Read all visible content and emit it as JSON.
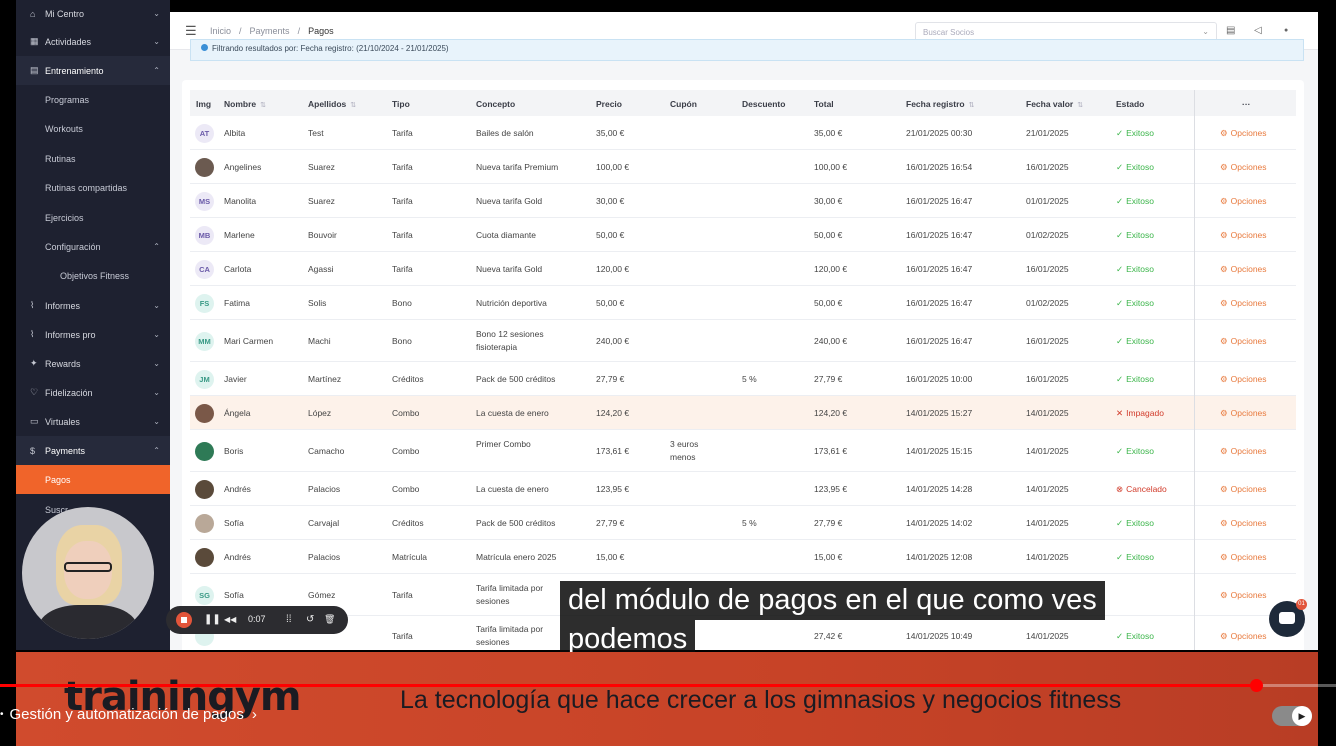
{
  "sidebar": {
    "items": [
      {
        "label": "Mi Centro",
        "icon": "home-icon",
        "chevron": "⌄"
      },
      {
        "label": "Actividades",
        "icon": "calendar-icon",
        "chevron": "⌄"
      },
      {
        "label": "Entrenamiento",
        "icon": "clipboard-icon",
        "chevron": "⌃"
      },
      {
        "label": "Programas"
      },
      {
        "label": "Workouts"
      },
      {
        "label": "Rutinas"
      },
      {
        "label": "Rutinas compartidas"
      },
      {
        "label": "Ejercicios"
      },
      {
        "label": "Configuración",
        "chevron": "⌃"
      },
      {
        "label": "Objetivos Fitness"
      },
      {
        "label": "Informes",
        "icon": "chart-icon",
        "chevron": "⌄"
      },
      {
        "label": "Informes pro",
        "icon": "chart-pro-icon",
        "chevron": "⌄"
      },
      {
        "label": "Rewards",
        "icon": "gift-icon",
        "chevron": "⌄"
      },
      {
        "label": "Fidelización",
        "icon": "heart-icon",
        "chevron": "⌄"
      },
      {
        "label": "Virtuales",
        "icon": "video-icon",
        "chevron": "⌄"
      },
      {
        "label": "Payments",
        "icon": "dollar-icon",
        "chevron": "⌃"
      },
      {
        "label": "Pagos"
      },
      {
        "label": "Suscr"
      }
    ]
  },
  "topbar": {
    "menu_glyph": "☰",
    "breadcrumb": [
      "Inicio",
      "/",
      "Payments",
      "/",
      "Pagos"
    ],
    "search_placeholder": "Buscar Socios",
    "search_caret": "⌄",
    "icons": [
      "▤",
      "◁",
      "●"
    ]
  },
  "filter": {
    "text": "Filtrando resultados por: Fecha registro: (21/10/2024 - 21/01/2025)"
  },
  "table": {
    "headers": [
      "Img",
      "Nombre",
      "Apellidos",
      "Tipo",
      "Concepto",
      "Precio",
      "Cupón",
      "Descuento",
      "Total",
      "Fecha registro",
      "Fecha valor",
      "Estado",
      "···"
    ],
    "options_label": "Opciones",
    "rows": [
      {
        "initials": "AT",
        "av_bg": "#ece9f6",
        "av_fg": "#6a5aa8",
        "nombre": "Albita",
        "apellidos": "Test",
        "tipo": "Tarifa",
        "concepto": "Bailes de salón",
        "precio": "35,00 €",
        "cupon": "",
        "descuento": "",
        "total": "35,00 €",
        "fecha_registro": "21/01/2025 00:30",
        "fecha_valor": "21/01/2025",
        "estado": "Exitoso",
        "estado_glyph": "✓",
        "status": "ok"
      },
      {
        "initials": "",
        "av_bg": "#6b5a50",
        "av_fg": "#fff",
        "nombre": "Angelines",
        "apellidos": "Suarez",
        "tipo": "Tarifa",
        "concepto": "Nueva tarifa Premium",
        "precio": "100,00 €",
        "cupon": "",
        "descuento": "",
        "total": "100,00 €",
        "fecha_registro": "16/01/2025 16:54",
        "fecha_valor": "16/01/2025",
        "estado": "Exitoso",
        "estado_glyph": "✓",
        "status": "ok"
      },
      {
        "initials": "MS",
        "av_bg": "#ece9f6",
        "av_fg": "#6a5aa8",
        "nombre": "Manolita",
        "apellidos": "Suarez",
        "tipo": "Tarifa",
        "concepto": "Nueva tarifa Gold",
        "precio": "30,00 €",
        "cupon": "",
        "descuento": "",
        "total": "30,00 €",
        "fecha_registro": "16/01/2025 16:47",
        "fecha_valor": "01/01/2025",
        "estado": "Exitoso",
        "estado_glyph": "✓",
        "status": "ok"
      },
      {
        "initials": "MB",
        "av_bg": "#ece9f6",
        "av_fg": "#6a5aa8",
        "nombre": "Marlene",
        "apellidos": "Bouvoir",
        "tipo": "Tarifa",
        "concepto": "Cuota diamante",
        "precio": "50,00 €",
        "cupon": "",
        "descuento": "",
        "total": "50,00 €",
        "fecha_registro": "16/01/2025 16:47",
        "fecha_valor": "01/02/2025",
        "estado": "Exitoso",
        "estado_glyph": "✓",
        "status": "ok"
      },
      {
        "initials": "CA",
        "av_bg": "#ece9f6",
        "av_fg": "#6a5aa8",
        "nombre": "Carlota",
        "apellidos": "Agassi",
        "tipo": "Tarifa",
        "concepto": "Nueva tarifa Gold",
        "precio": "120,00 €",
        "cupon": "",
        "descuento": "",
        "total": "120,00 €",
        "fecha_registro": "16/01/2025 16:47",
        "fecha_valor": "16/01/2025",
        "estado": "Exitoso",
        "estado_glyph": "✓",
        "status": "ok"
      },
      {
        "initials": "FS",
        "av_bg": "#def3ef",
        "av_fg": "#3a9a86",
        "nombre": "Fatima",
        "apellidos": "Solis",
        "tipo": "Bono",
        "concepto": "Nutrición deportiva",
        "precio": "50,00 €",
        "cupon": "",
        "descuento": "",
        "total": "50,00 €",
        "fecha_registro": "16/01/2025 16:47",
        "fecha_valor": "01/02/2025",
        "estado": "Exitoso",
        "estado_glyph": "✓",
        "status": "ok"
      },
      {
        "initials": "MM",
        "av_bg": "#def3ef",
        "av_fg": "#3a9a86",
        "nombre": "Mari Carmen",
        "apellidos": "Machi",
        "tipo": "Bono",
        "concepto": "Bono 12 sesiones fisioterapia",
        "precio": "240,00 €",
        "cupon": "",
        "descuento": "",
        "total": "240,00 €",
        "fecha_registro": "16/01/2025 16:47",
        "fecha_valor": "16/01/2025",
        "estado": "Exitoso",
        "estado_glyph": "✓",
        "status": "ok",
        "tall": true
      },
      {
        "initials": "JM",
        "av_bg": "#def3ef",
        "av_fg": "#3a9a86",
        "nombre": "Javier",
        "apellidos": "Martínez",
        "tipo": "Créditos",
        "concepto": "Pack de 500 créditos",
        "precio": "27,79 €",
        "cupon": "",
        "descuento": "5 %",
        "total": "27,79 €",
        "fecha_registro": "16/01/2025 10:00",
        "fecha_valor": "16/01/2025",
        "estado": "Exitoso",
        "estado_glyph": "✓",
        "status": "ok"
      },
      {
        "initials": "",
        "av_bg": "#7a5848",
        "av_fg": "#fff",
        "nombre": "Ángela",
        "apellidos": "López",
        "tipo": "Combo",
        "concepto": "La cuesta de enero",
        "precio": "124,20 €",
        "cupon": "",
        "descuento": "",
        "total": "124,20 €",
        "fecha_registro": "14/01/2025 15:27",
        "fecha_valor": "14/01/2025",
        "estado": "Impagado",
        "estado_glyph": "✕",
        "status": "bad",
        "highlight": true
      },
      {
        "initials": "",
        "av_bg": "#2e7a56",
        "av_fg": "#fff",
        "nombre": "Boris",
        "apellidos": "Camacho",
        "tipo": "Combo",
        "concepto": "Primer Combo",
        "precio": "173,61 €",
        "cupon": "3 euros menos",
        "descuento": "",
        "total": "173,61 €",
        "fecha_registro": "14/01/2025 15:15",
        "fecha_valor": "14/01/2025",
        "estado": "Exitoso",
        "estado_glyph": "✓",
        "status": "ok",
        "tall": true
      },
      {
        "initials": "",
        "av_bg": "#5a4a3a",
        "av_fg": "#fff",
        "nombre": "Andrés",
        "apellidos": "Palacios",
        "tipo": "Combo",
        "concepto": "La cuesta de enero",
        "precio": "123,95 €",
        "cupon": "",
        "descuento": "",
        "total": "123,95 €",
        "fecha_registro": "14/01/2025 14:28",
        "fecha_valor": "14/01/2025",
        "estado": "Cancelado",
        "estado_glyph": "⊗",
        "status": "bad"
      },
      {
        "initials": "",
        "av_bg": "#b9a898",
        "av_fg": "#fff",
        "nombre": "Sofía",
        "apellidos": "Carvajal",
        "tipo": "Créditos",
        "concepto": "Pack de 500 créditos",
        "precio": "27,79 €",
        "cupon": "",
        "descuento": "5 %",
        "total": "27,79 €",
        "fecha_registro": "14/01/2025 14:02",
        "fecha_valor": "14/01/2025",
        "estado": "Exitoso",
        "estado_glyph": "✓",
        "status": "ok"
      },
      {
        "initials": "",
        "av_bg": "#5a4a3a",
        "av_fg": "#fff",
        "nombre": "Andrés",
        "apellidos": "Palacios",
        "tipo": "Matrícula",
        "concepto": "Matrícula enero 2025",
        "precio": "15,00 €",
        "cupon": "",
        "descuento": "",
        "total": "15,00 €",
        "fecha_registro": "14/01/2025 12:08",
        "fecha_valor": "14/01/2025",
        "estado": "Exitoso",
        "estado_glyph": "✓",
        "status": "ok"
      },
      {
        "initials": "SG",
        "av_bg": "#def3ef",
        "av_fg": "#3a9a86",
        "nombre": "Sofía",
        "apellidos": "Gómez",
        "tipo": "Tarifa",
        "concepto": "Tarifa limitada por sesiones",
        "precio": "",
        "cupon": "",
        "descuento": "",
        "total": "",
        "fecha_registro": "",
        "fecha_valor": "",
        "estado": "",
        "estado_glyph": "",
        "status": "ok",
        "tall": true
      },
      {
        "initials": "",
        "av_bg": "#def3ef",
        "av_fg": "#3a9a86",
        "nombre": "",
        "apellidos": "",
        "tipo": "Tarifa",
        "concepto": "Tarifa limitada por sesiones",
        "precio": "",
        "cupon": "",
        "descuento": "",
        "total": "27,42 €",
        "fecha_registro": "14/01/2025 10:49",
        "fecha_valor": "14/01/2025",
        "estado": "Exitoso",
        "estado_glyph": "✓",
        "status": "ok",
        "tall": true
      }
    ]
  },
  "overlay": {
    "subtitle_line1": "del módulo de pagos en el que como ves",
    "subtitle_line2": "podemos",
    "rec_time": "0:07",
    "rec_icons": [
      "❚❚",
      "◀◀",
      "⁞⁞",
      "↺",
      "🗑"
    ],
    "chat_badge": "01"
  },
  "banner": {
    "logo": "trainingym",
    "tagline": "La tecnología que hace crecer a los gimnasios y negocios fitness"
  },
  "player": {
    "progress": 0.94,
    "chapter_bullet": "•",
    "chapter": "Gestión y automatización de pagos",
    "chapter_arrow": "›",
    "autoplay_glyph": "▶"
  }
}
